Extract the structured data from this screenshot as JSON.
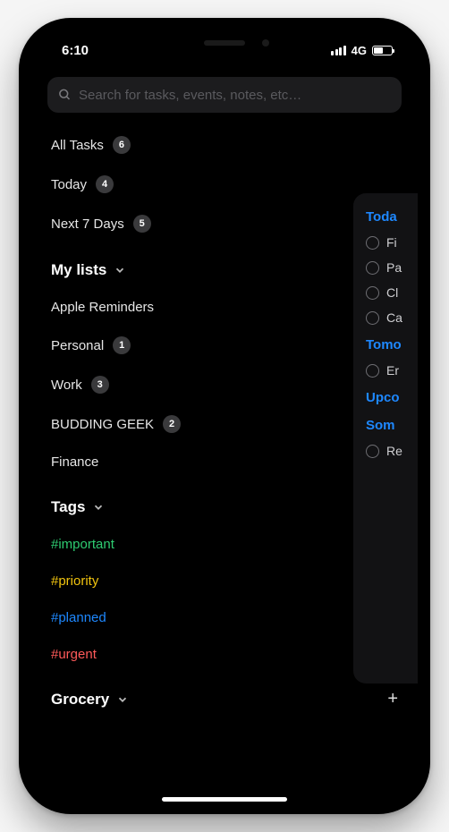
{
  "status": {
    "time": "6:10",
    "network": "4G"
  },
  "search": {
    "placeholder": "Search for tasks, events, notes, etc…"
  },
  "nav": [
    {
      "label": "All Tasks",
      "count": "6"
    },
    {
      "label": "Today",
      "count": "4"
    },
    {
      "label": "Next 7 Days",
      "count": "5"
    }
  ],
  "sections": {
    "lists": {
      "title": "My lists",
      "items": [
        {
          "label": "Apple Reminders",
          "count": null
        },
        {
          "label": "Personal",
          "count": "1"
        },
        {
          "label": "Work",
          "count": "3"
        },
        {
          "label": "BUDDING GEEK",
          "count": "2"
        },
        {
          "label": "Finance",
          "count": null
        }
      ]
    },
    "tags": {
      "title": "Tags",
      "items": [
        {
          "label": "#important",
          "color": "#2ecc71"
        },
        {
          "label": "#priority",
          "color": "#f1c40f"
        },
        {
          "label": "#planned",
          "color": "#1e88ff"
        },
        {
          "label": "#urgent",
          "color": "#ff5a5a"
        }
      ]
    },
    "grocery": {
      "title": "Grocery"
    }
  },
  "peek": {
    "sections": [
      {
        "header": "Toda",
        "tasks": [
          "Fi",
          "Pa",
          "Cl",
          "Ca"
        ]
      },
      {
        "header": "Tomo",
        "tasks": [
          "Er"
        ]
      },
      {
        "header": "Upco",
        "tasks": []
      },
      {
        "header": "Som",
        "tasks": [
          "Re"
        ]
      }
    ]
  }
}
